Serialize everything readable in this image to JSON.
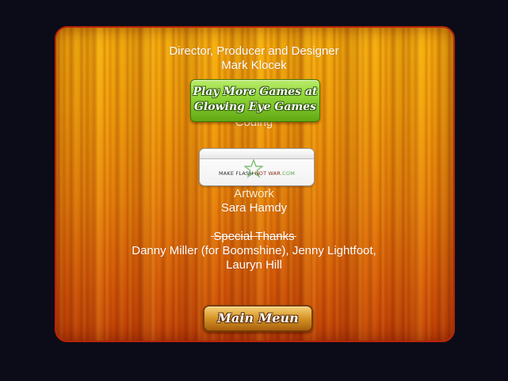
{
  "credits": {
    "director_role": "Director, Producer and Designer",
    "director_name": "Mark Klocek",
    "coding_role": "Coding",
    "artwork_role": "Artwork",
    "artwork_name": "Sara Hamdy",
    "thanks_role": "Special Thanks",
    "thanks_line1": "Danny Miller (for Boomshine), Jenny Lightfoot,",
    "thanks_line2": "Lauryn Hill"
  },
  "promo_button": {
    "line1": "Play More Games at",
    "line2": "Glowing Eye Games"
  },
  "sponsor": {
    "part1": "MAKE FLASH ",
    "part2": "NOT WAR",
    "part3": ".COM",
    "icon": "star-logo-icon"
  },
  "main_menu_button": {
    "label": "Main Meun"
  },
  "colors": {
    "background": "#0b0c17",
    "panel_top": "#f7b20c",
    "panel_bottom": "#c24206",
    "panel_border": "#b8240a",
    "promo_green": "#8cd235",
    "menu_gold": "#d99a2c"
  }
}
